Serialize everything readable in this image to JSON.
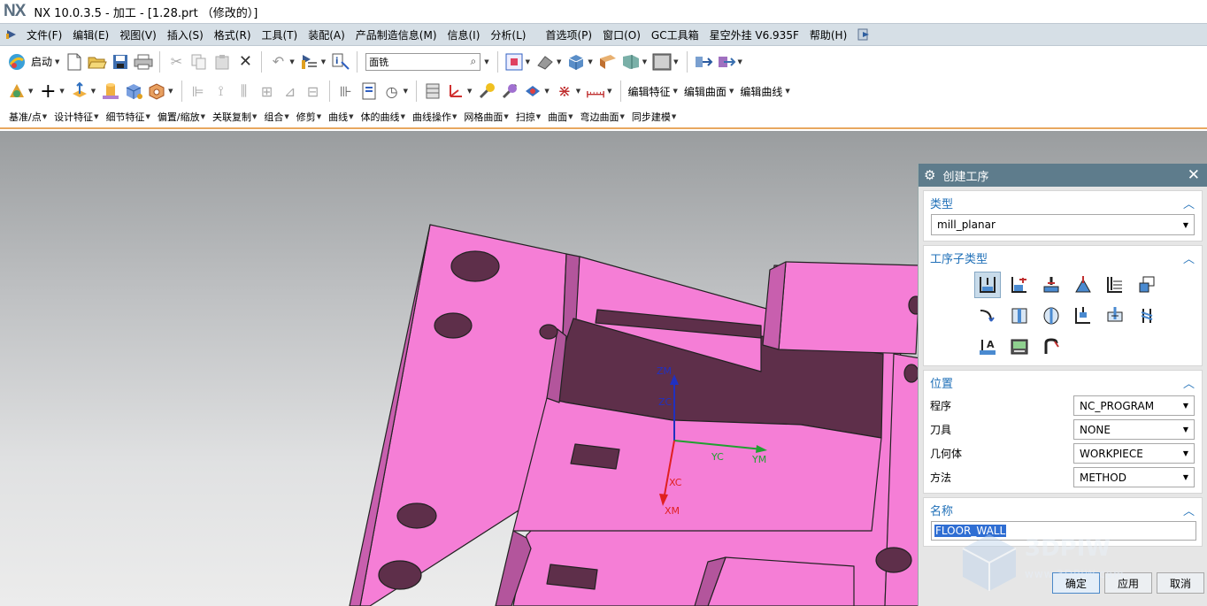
{
  "window": {
    "logo": "NX",
    "title": "NX 10.0.3.5 - 加工 - [1.28.prt （修改的）]"
  },
  "menu": [
    "文件(F)",
    "编辑(E)",
    "视图(V)",
    "插入(S)",
    "格式(R)",
    "工具(T)",
    "装配(A)",
    "产品制造信息(M)",
    "信息(I)",
    "分析(L)",
    "首选项(P)",
    "窗口(O)",
    "GC工具箱",
    "星空外挂 V6.935F",
    "帮助(H)"
  ],
  "toolbar1": {
    "start_label": "启动",
    "filter_value": "面铣"
  },
  "toolbar2": {
    "edit_feature": "编辑特征",
    "edit_surface": "编辑曲面",
    "edit_curve": "编辑曲线"
  },
  "toolbar3": [
    "基准/点",
    "设计特征",
    "细节特征",
    "偏置/缩放",
    "关联复制",
    "组合",
    "修剪",
    "曲线",
    "体的曲线",
    "曲线操作",
    "网格曲面",
    "扫掠",
    "曲面",
    "弯边曲面",
    "同步建模"
  ],
  "csys": {
    "zm": "ZM",
    "zc": "ZC",
    "yc": "YC",
    "ym": "YM",
    "xc": "XC",
    "xm": "XM"
  },
  "dialog": {
    "title": "创建工序",
    "type_section": "类型",
    "type_value": "mill_planar",
    "subtype_section": "工序子类型",
    "location_section": "位置",
    "program_label": "程序",
    "program_value": "NC_PROGRAM",
    "tool_label": "刀具",
    "tool_value": "NONE",
    "geometry_label": "几何体",
    "geometry_value": "WORKPIECE",
    "method_label": "方法",
    "method_value": "METHOD",
    "name_section": "名称",
    "name_value": "FLOOR_WALL",
    "ok": "确定",
    "apply": "应用",
    "cancel": "取消"
  },
  "watermark": "www.3DPIW.com",
  "colors": {
    "part": "#f57ed6",
    "part_dark": "#5e2f4a",
    "dialog_header": "#5e7c8c",
    "accent": "#2070b8"
  }
}
